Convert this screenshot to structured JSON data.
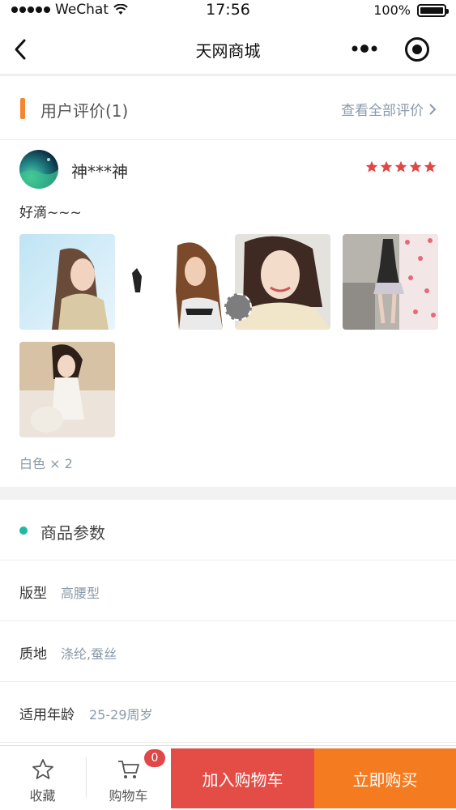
{
  "status_bar": {
    "carrier": "WeChat",
    "time": "17:56",
    "battery": "100%"
  },
  "nav": {
    "title": "天网商城"
  },
  "reviews": {
    "title": "用户评价(1)",
    "view_all": "查看全部评价",
    "rating": 5,
    "review": {
      "username": "神***神",
      "comment": "好滴~~~",
      "spec": "白色 × 2",
      "photo_count": 5
    }
  },
  "params": {
    "title": "商品参数",
    "rows": [
      {
        "key": "版型",
        "value": "高腰型"
      },
      {
        "key": "质地",
        "value": "涤纶,蚕丝"
      },
      {
        "key": "适用年龄",
        "value": "25-29周岁"
      }
    ]
  },
  "bottom_bar": {
    "favorite_label": "收藏",
    "cart_label": "购物车",
    "cart_count": "0",
    "add_to_cart": "加入购物车",
    "buy_now": "立即购买"
  },
  "colors": {
    "accent_orange": "#f47b20",
    "accent_red": "#e44d46",
    "teal": "#20b6a8",
    "star_red": "#e04848"
  }
}
